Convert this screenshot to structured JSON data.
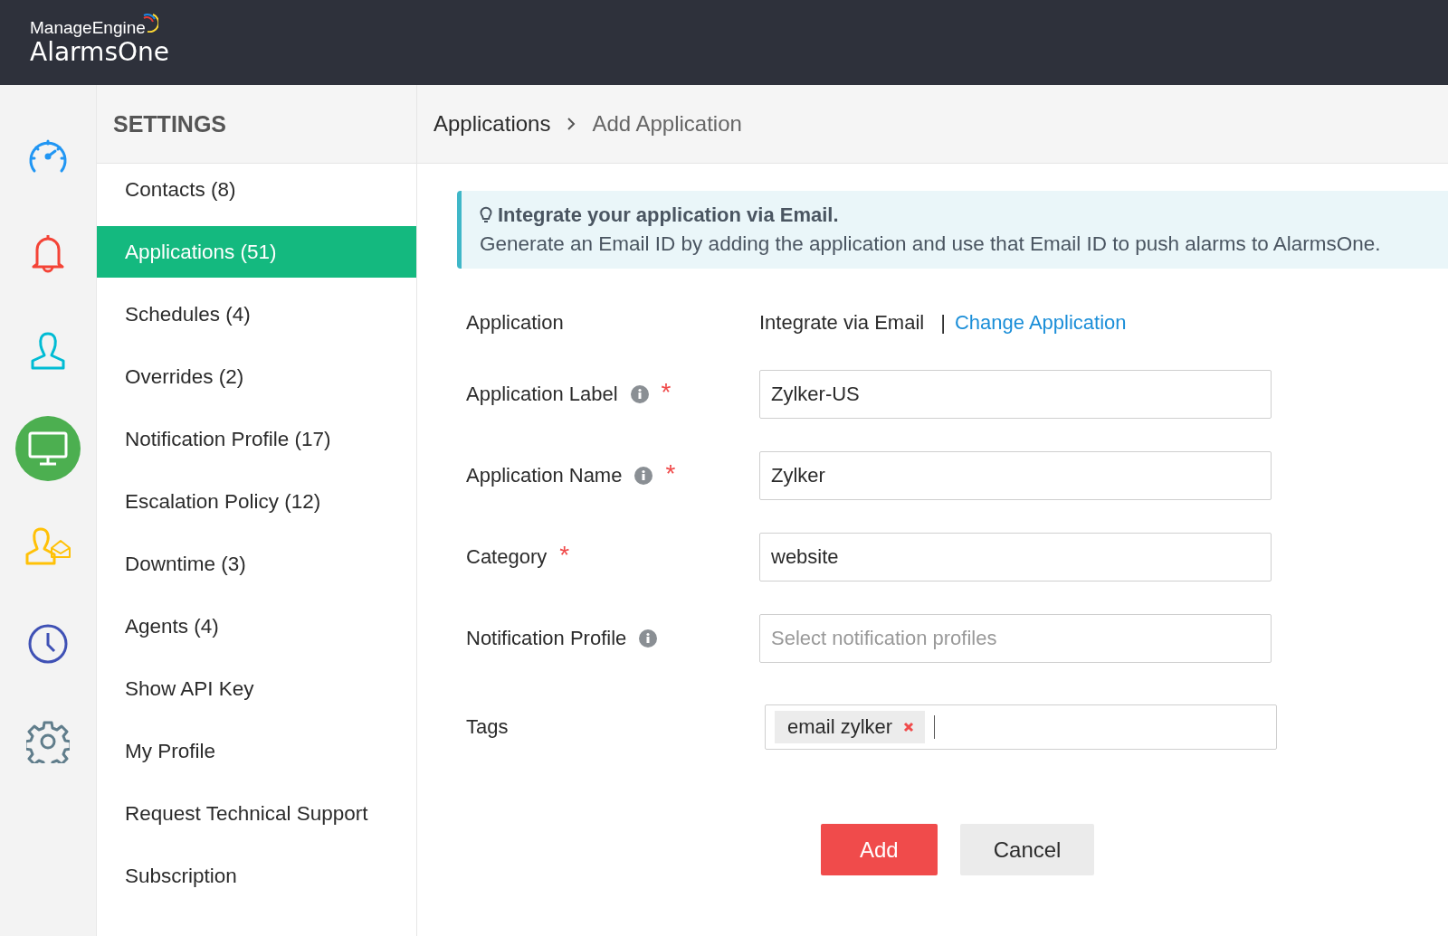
{
  "header": {
    "brand": "ManageEngine",
    "product": "AlarmsOne"
  },
  "rail": [
    {
      "kind": "gauge",
      "color": "#2196f3",
      "selected": false
    },
    {
      "kind": "bell",
      "color": "#f44336",
      "selected": false
    },
    {
      "kind": "user",
      "color": "#00bcd4",
      "selected": false
    },
    {
      "kind": "monitor",
      "color": "#4caf50",
      "selected": true
    },
    {
      "kind": "user-mail",
      "color": "#ffc107",
      "selected": false
    },
    {
      "kind": "clock",
      "color": "#3f51b5",
      "selected": false
    },
    {
      "kind": "gear",
      "color": "#607d8b",
      "selected": false
    }
  ],
  "sidebar": {
    "title": "SETTINGS",
    "items": [
      {
        "label": "Contacts (8)",
        "selected": false
      },
      {
        "label": "Applications (51)",
        "selected": true
      },
      {
        "label": "Schedules (4)",
        "selected": false
      },
      {
        "label": "Overrides (2)",
        "selected": false
      },
      {
        "label": "Notification Profile (17)",
        "selected": false
      },
      {
        "label": "Escalation Policy (12)",
        "selected": false
      },
      {
        "label": "Downtime (3)",
        "selected": false
      },
      {
        "label": "Agents (4)",
        "selected": false
      },
      {
        "label": "Show API Key",
        "selected": false
      },
      {
        "label": "My Profile",
        "selected": false
      },
      {
        "label": "Request Technical Support",
        "selected": false
      },
      {
        "label": "Subscription",
        "selected": false
      }
    ]
  },
  "breadcrumb": [
    "Applications",
    "Add Application"
  ],
  "info": {
    "title": "Integrate your application via Email.",
    "text": "Generate an Email ID by adding the application and use that Email ID to push alarms to AlarmsOne."
  },
  "form": [
    {
      "kind": "static",
      "label": "Application",
      "info": false,
      "value": "Integrate via Email",
      "separator": "|",
      "link": "Change Application"
    },
    {
      "kind": "input",
      "label": "Application Label",
      "info": true,
      "required_mark": "*",
      "value": "Zylker-US"
    },
    {
      "kind": "input",
      "label": "Application Name",
      "info": true,
      "required_mark": "*",
      "value": "Zylker"
    },
    {
      "kind": "input",
      "label": "Category",
      "info": false,
      "required_mark": "*",
      "value": "website"
    },
    {
      "kind": "input",
      "label": "Notification Profile",
      "info": true,
      "placeholder": "Select notification profiles"
    },
    {
      "kind": "tags",
      "label": "Tags",
      "info": false,
      "tags": [
        "email zylker"
      ]
    }
  ],
  "buttons": [
    {
      "label": "Add",
      "kind": "primary"
    },
    {
      "label": "Cancel",
      "kind": "secondary"
    }
  ]
}
